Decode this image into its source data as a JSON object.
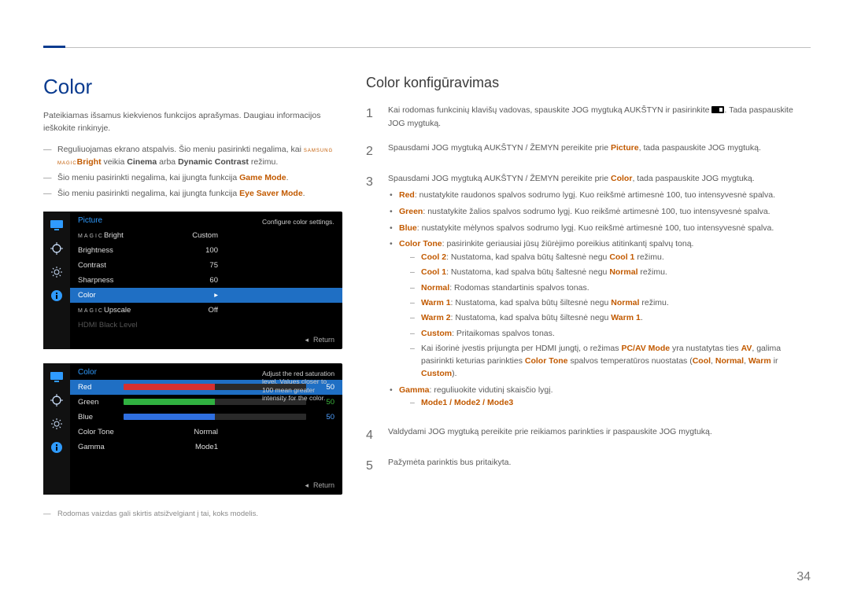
{
  "page_number": "34",
  "left": {
    "title": "Color",
    "intro": "Pateikiamas išsamus kiekvienos funkcijos aprašymas. Daugiau informacijos ieškokite rinkinyje.",
    "notes": {
      "n1_pre": "Reguliuojamas ekrano atspalvis. Šio meniu pasirinkti negalima, kai ",
      "n1_magic": "SAMSUNG MAGIC",
      "n1_bright": "Bright",
      "n1_mid": " veikia ",
      "n1_cinema": "Cinema",
      "n1_or": " arba ",
      "n1_dc": "Dynamic Contrast",
      "n1_end": " režimu.",
      "n2_pre": "Šio meniu pasirinkti negalima, kai įjungta funkcija ",
      "n2_hl": "Game Mode",
      "n2_end": ".",
      "n3_pre": "Šio meniu pasirinkti negalima, kai įjungta funkcija ",
      "n3_hl": "Eye Saver Mode",
      "n3_end": "."
    },
    "osd1": {
      "title": "Picture",
      "tip": "Configure color settings.",
      "foot": "Return",
      "rows": [
        {
          "label_magic": "MAGIC",
          "label_suffix": "Bright",
          "value": "Custom"
        },
        {
          "label": "Brightness",
          "value": "100"
        },
        {
          "label": "Contrast",
          "value": "75"
        },
        {
          "label": "Sharpness",
          "value": "60"
        },
        {
          "label": "Color",
          "value": ""
        },
        {
          "label_magic": "MAGIC",
          "label_suffix": "Upscale",
          "value": "Off"
        },
        {
          "label": "HDMI Black Level",
          "value": ""
        }
      ]
    },
    "osd2": {
      "title": "Color",
      "tip": "Adjust the red saturation level. Values closer to 100 mean greater intensity for the color.",
      "foot": "Return",
      "rows": [
        {
          "label": "Red",
          "value": "50"
        },
        {
          "label": "Green",
          "value": "50"
        },
        {
          "label": "Blue",
          "value": "50"
        },
        {
          "label": "Color Tone",
          "value": "Normal"
        },
        {
          "label": "Gamma",
          "value": "Mode1"
        }
      ]
    },
    "footnote": "Rodomas vaizdas gali skirtis atsižvelgiant į tai, koks modelis."
  },
  "right": {
    "title": "Color konfigūravimas",
    "step1_a": "Kai rodomas funkcinių klavišų vadovas, spauskite JOG mygtuką AUKŠTYN ir pasirinkite ",
    "step1_b": ". Tada paspauskite JOG mygtuką.",
    "step2_a": "Spausdami JOG mygtuką AUKŠTYN / ŽEMYN pereikite prie ",
    "step2_hl": "Picture",
    "step2_b": ", tada paspauskite JOG mygtuką.",
    "step3_a": "Spausdami JOG mygtuką AUKŠTYN / ŽEMYN pereikite prie ",
    "step3_hl": "Color",
    "step3_b": ", tada paspauskite JOG mygtuką.",
    "b_red_hl": "Red",
    "b_red": ": nustatykite raudonos spalvos sodrumo lygį. Kuo reikšmė artimesnė 100, tuo intensyvesnė spalva.",
    "b_green_hl": "Green",
    "b_green": ": nustatykite žalios spalvos sodrumo lygį. Kuo reikšmė artimesnė 100, tuo intensyvesnė spalva.",
    "b_blue_hl": "Blue",
    "b_blue": ": nustatykite mėlynos spalvos sodrumo lygį. Kuo reikšmė artimesnė 100, tuo intensyvesnė spalva.",
    "b_ct_hl": "Color Tone",
    "b_ct": ": pasirinkite geriausiai jūsų žiūrėjimo poreikius atitinkantį spalvų toną.",
    "ct": {
      "cool2_hl": "Cool 2",
      "cool2_a": ": Nustatoma, kad spalva būtų šaltesnė negu ",
      "cool2_b": "Cool 1",
      "cool2_end": " režimu.",
      "cool1_hl": "Cool 1",
      "cool1_a": ": Nustatoma, kad spalva būtų šaltesnė negu ",
      "cool1_b": "Normal",
      "cool1_end": " režimu.",
      "normal_hl": "Normal",
      "normal_a": ": Rodomas standartinis spalvos tonas.",
      "warm1_hl": "Warm 1",
      "warm1_a": ": Nustatoma, kad spalva būtų šiltesnė negu ",
      "warm1_b": "Normal",
      "warm1_end": " režimu.",
      "warm2_hl": "Warm 2",
      "warm2_a": ": Nustatoma, kad spalva būtų šiltesnė negu ",
      "warm2_b": "Warm 1",
      "warm2_end": ".",
      "custom_hl": "Custom",
      "custom_a": ": Pritaikomas spalvos tonas.",
      "hdmi_a": "Kai išorinė įvestis prijungta per HDMI jungtį, o režimas ",
      "hdmi_b": "PC/AV Mode",
      "hdmi_c": " yra nustatytas ties ",
      "hdmi_d": "AV",
      "hdmi_e": ", galima pasirinkti keturias parinkties ",
      "hdmi_f": "Color Tone",
      "hdmi_g": " spalvos temperatūros nuostatas (",
      "hdmi_h": "Cool",
      "hdmi_i": ", ",
      "hdmi_j": "Normal",
      "hdmi_k": ", ",
      "hdmi_l": "Warm",
      "hdmi_m": " ir ",
      "hdmi_n": "Custom",
      "hdmi_o": ")."
    },
    "b_gamma_hl": "Gamma",
    "b_gamma": ": reguliuokite vidutinį skaisčio lygį.",
    "gamma_modes": "Mode1 / Mode2 / Mode3",
    "step4": "Valdydami JOG mygtuką pereikite prie reikiamos parinkties ir paspauskite JOG mygtuką.",
    "step5": "Pažymėta parinktis bus pritaikyta."
  }
}
